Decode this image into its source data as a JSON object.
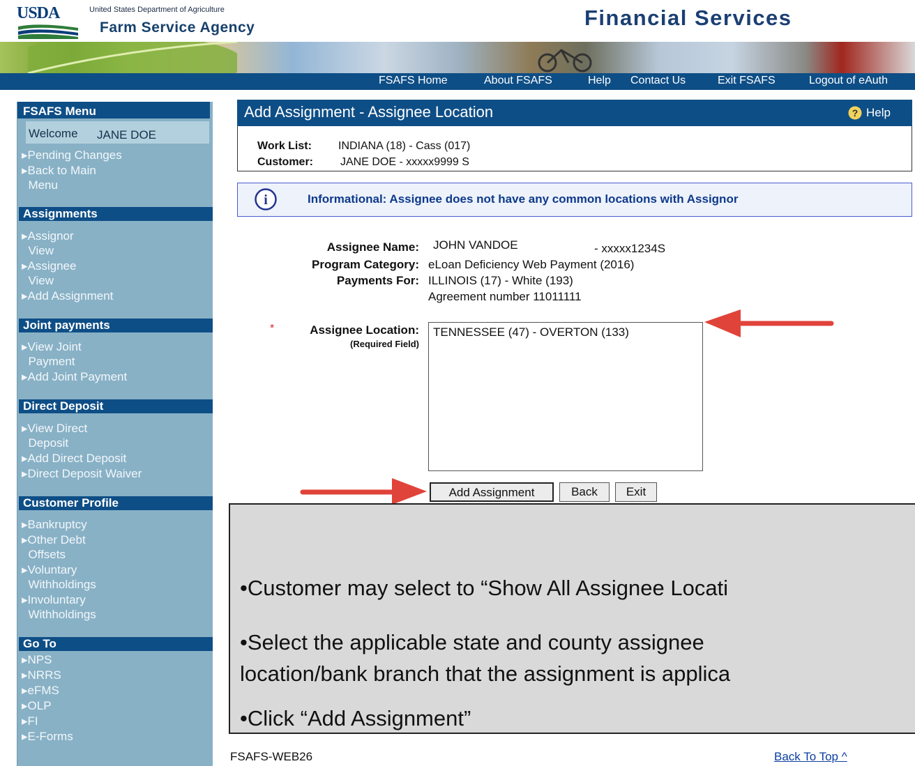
{
  "header": {
    "logo_text": "USDA",
    "department": "United States Department of Agriculture",
    "agency": "Farm Service Agency",
    "site_title": "Financial Services"
  },
  "nav": [
    "FSAFS Home",
    "About FSAFS",
    "Help",
    "Contact Us",
    "Exit FSAFS",
    "Logout of eAuth"
  ],
  "sidebar": {
    "menu_title": "FSAFS Menu",
    "welcome_label": "Welcome",
    "welcome_user": "JANE DOE",
    "top_links": [
      "▸Pending Changes",
      "▸Back to Main\n  Menu"
    ],
    "sections": [
      {
        "title": "Assignments",
        "items": [
          "▸Assignor\n  View",
          "▸Assignee\n  View",
          "▸Add Assignment"
        ]
      },
      {
        "title": "Joint payments",
        "items": [
          "▸View Joint\n  Payment",
          "▸Add Joint Payment"
        ]
      },
      {
        "title": "Direct Deposit",
        "items": [
          "▸View Direct\n  Deposit",
          "▸Add Direct Deposit",
          "▸Direct Deposit Waiver"
        ]
      },
      {
        "title": "Customer Profile",
        "items": [
          "▸Bankruptcy",
          "▸Other Debt\n  Offsets",
          "▸Voluntary\n  Withholdings",
          "▸Involuntary\n  Withholdings"
        ]
      },
      {
        "title": "Go To",
        "items": [
          "▸NPS",
          "▸NRRS",
          "▸eFMS",
          "▸OLP",
          "▸FI",
          "▸E-Forms"
        ]
      }
    ]
  },
  "content": {
    "title": "Add Assignment - Assignee Location",
    "help_label": "Help",
    "worklist_label": "Work List:",
    "worklist_value": "INDIANA (18) - Cass (017)",
    "customer_label": "Customer:",
    "customer_value": "JANE DOE - xxxxx9999 S",
    "info_message": "Informational: Assignee does not have any common locations with Assignor",
    "assignee_name_label": "Assignee Name:",
    "assignee_name_value": "JOHN VANDOE",
    "assignee_id": "- xxxxx1234S",
    "program_category_label": "Program Category:",
    "program_category_value": "eLoan Deficiency Web Payment (2016)",
    "payments_for_label": "Payments For:",
    "payments_for_value": "ILLINOIS (17) - White (193)",
    "agreement_value": "Agreement number 11011111",
    "required_marker": "*",
    "location_label": "Assignee Location:",
    "location_required_note": "(Required Field)",
    "location_option": "TENNESSEE (47) - OVERTON (133)",
    "buttons": {
      "add": "Add Assignment",
      "back": "Back",
      "exit": "Exit"
    }
  },
  "callout": {
    "bullets": [
      "•Customer may select to “Show All Assignee Locati",
      "•Select the applicable state and county assignee",
      "location/bank branch that the assignment is applica",
      "•Click “Add Assignment”"
    ]
  },
  "footer": {
    "code": "FSAFS-WEB26",
    "back_to_top": "Back To Top ^"
  },
  "colors": {
    "nav_blue": "#0e4e86",
    "sidebar": "#88b1c6",
    "arrow": "#e0433a"
  }
}
